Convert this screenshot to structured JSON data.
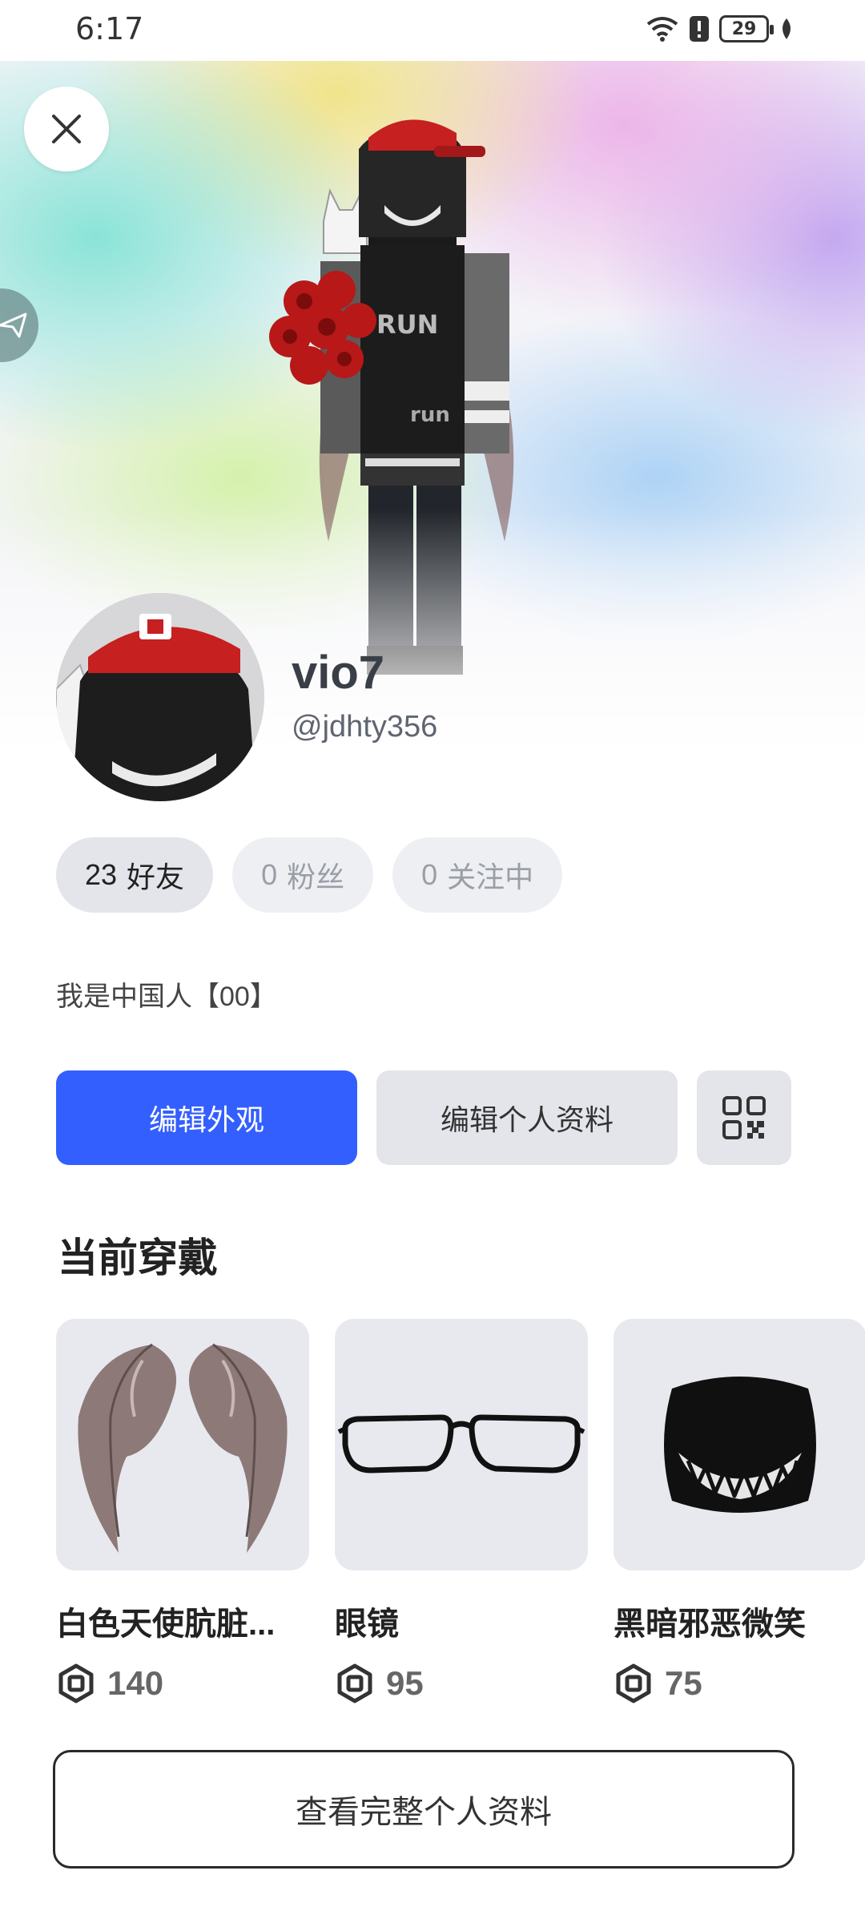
{
  "status_bar": {
    "time": "6:17",
    "battery": "29"
  },
  "profile": {
    "display_name": "vio7",
    "username": "@jdhty356",
    "bio": "我是中国人【00】"
  },
  "stats": [
    {
      "count": "23",
      "label": "好友"
    },
    {
      "count": "0",
      "label": "粉丝"
    },
    {
      "count": "0",
      "label": "关注中"
    }
  ],
  "actions": {
    "edit_avatar": "编辑外观",
    "edit_profile": "编辑个人资料",
    "qr_icon": "qr-code-icon"
  },
  "section": {
    "title": "当前穿戴"
  },
  "items": [
    {
      "name": "白色天使肮脏...",
      "price": "140",
      "icon": "angel-wings"
    },
    {
      "name": "眼镜",
      "price": "95",
      "icon": "glasses"
    },
    {
      "name": "黑暗邪恶微笑",
      "price": "75",
      "icon": "evil-smile-face"
    }
  ],
  "footer": {
    "view_full_profile": "查看完整个人资料"
  },
  "colors": {
    "primary": "#335fff",
    "pill_bg": "#eeeff2",
    "card_bg": "#e8e9ee"
  }
}
